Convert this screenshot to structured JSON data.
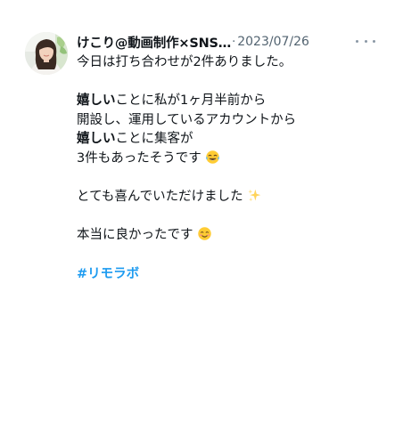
{
  "tweet": {
    "author": {
      "display_name": "けこり@動画制作×SNS…",
      "avatar_alt": "avatar-photo"
    },
    "separator": "·",
    "date": "2023/07/26",
    "more_icon": "ellipsis-horizontal-icon",
    "lines": {
      "l1": "今日は打ち合わせが2件ありました。",
      "l2_bold": "嬉しい",
      "l2_rest": "ことに私が1ヶ月半前から",
      "l3": "開設し、運用しているアカウントから",
      "l4_bold": "嬉しい",
      "l4_rest": "ことに集客が",
      "l5": "3件もあったそうです",
      "l6": "とても喜んでいただけました",
      "l7": "本当に良かったです"
    },
    "emojis": {
      "laugh": "face-with-tears-of-joy-icon",
      "sparkles": "sparkles-icon",
      "smile": "smiling-face-icon"
    },
    "hashtag": "#リモラボ",
    "colors": {
      "text": "#0f1419",
      "secondary": "#536471",
      "link": "#1d9bf0"
    }
  }
}
